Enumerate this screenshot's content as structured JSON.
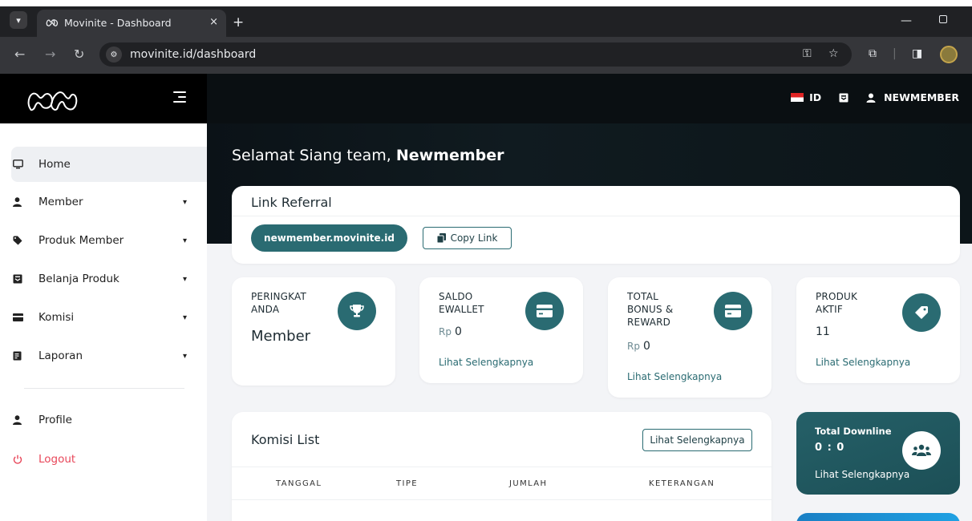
{
  "browser": {
    "tab_title": "Movinite - Dashboard",
    "tab_close": "×",
    "new_tab": "+",
    "url": "movinite.id/dashboard",
    "minimize": "—"
  },
  "header": {
    "language": "ID",
    "username": "NEWMEMBER"
  },
  "greeting": {
    "prefix": "Selamat Siang team,",
    "name": "Newmember"
  },
  "sidebar": {
    "items": [
      {
        "label": "Home",
        "icon": "monitor-icon",
        "has_chevron": false,
        "active": true
      },
      {
        "label": "Member",
        "icon": "user-icon",
        "has_chevron": true
      },
      {
        "label": "Produk Member",
        "icon": "tag-icon",
        "has_chevron": true
      },
      {
        "label": "Belanja Produk",
        "icon": "archive-icon",
        "has_chevron": true
      },
      {
        "label": "Komisi",
        "icon": "credit-card-icon",
        "has_chevron": true
      },
      {
        "label": "Laporan",
        "icon": "report-icon",
        "has_chevron": true
      }
    ],
    "profile": "Profile",
    "logout": "Logout"
  },
  "referral": {
    "title": "Link Referral",
    "link": "newmember.movinite.id",
    "copy_label": "Copy Link"
  },
  "stats": {
    "peringkat": {
      "label_1": "PERINGKAT",
      "label_2": "ANDA",
      "value": "Member"
    },
    "saldo": {
      "label_1": "SALDO",
      "label_2": "EWALLET",
      "currency": "Rp",
      "value": "0",
      "link": "Lihat Selengkapnya"
    },
    "bonus": {
      "label_1": "TOTAL",
      "label_2": "BONUS &",
      "label_3": "REWARD",
      "currency": "Rp",
      "value": "0",
      "link": "Lihat Selengkapnya"
    },
    "produk": {
      "label_1": "PRODUK",
      "label_2": "AKTIF",
      "value": "11",
      "link": "Lihat Selengkapnya"
    }
  },
  "komisi": {
    "title": "Komisi List",
    "more": "Lihat Selengkapnya",
    "columns": [
      "TANGGAL",
      "TIPE",
      "JUMLAH",
      "KETERANGAN"
    ]
  },
  "downline": {
    "label": "Total Downline",
    "value": "0 : 0",
    "link": "Lihat Selengkapnya"
  },
  "colors": {
    "accent": "#2a6b72",
    "logout": "#e8475a",
    "header": "#0a0f12"
  }
}
